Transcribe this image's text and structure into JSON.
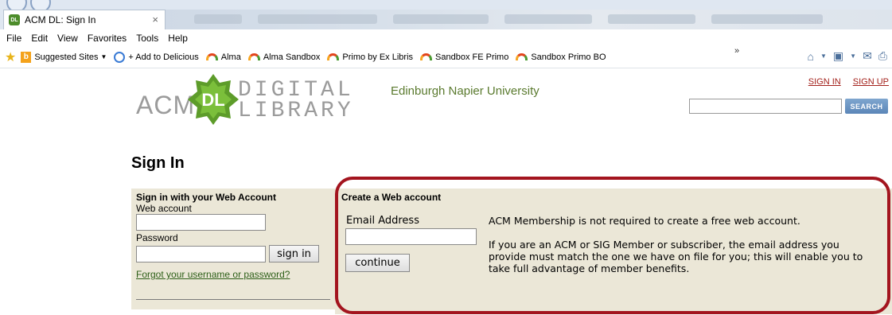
{
  "browser": {
    "tab_title": "ACM DL: Sign In",
    "tab_close": "×",
    "menu": [
      "File",
      "Edit",
      "View",
      "Favorites",
      "Tools",
      "Help"
    ],
    "favorites": {
      "suggested_sites": "Suggested Sites",
      "add_delicious": "+ Add to Delicious",
      "items": [
        "Alma",
        "Alma Sandbox",
        "Primo by Ex Libris",
        "Sandbox FE Primo",
        "Sandbox Primo BO"
      ]
    },
    "overflow_chevrons": "»"
  },
  "header": {
    "logo_acm": "ACM",
    "logo_badge": "DL",
    "logo_line1": "DIGITAL",
    "logo_line2": "LIBRARY",
    "institution": "Edinburgh Napier University",
    "sign_in_link": "SIGN IN",
    "sign_up_link": "SIGN UP",
    "search_button": "SEARCH",
    "search_value": ""
  },
  "main": {
    "title": "Sign In",
    "signin": {
      "heading": "Sign in with your Web Account",
      "account_label": "Web account",
      "password_label": "Password",
      "signin_button": "sign in",
      "forgot_link": "Forgot your username or password?",
      "account_value": "",
      "password_value": ""
    },
    "create": {
      "heading": "Create a Web account",
      "email_label": "Email Address",
      "email_value": "",
      "continue_button": "continue",
      "info_1": "ACM Membership is not required to create a free web account.",
      "info_2": "If you are an ACM or SIG Member or subscriber, the email address you provide must match the one we have on file for you; this will enable you to take full advantage of member benefits."
    }
  },
  "colors": {
    "accent_red": "#a3141e",
    "panel_bg": "#ebe7d7",
    "link_green": "#2d5f18",
    "auth_link_red": "#a3211b"
  }
}
